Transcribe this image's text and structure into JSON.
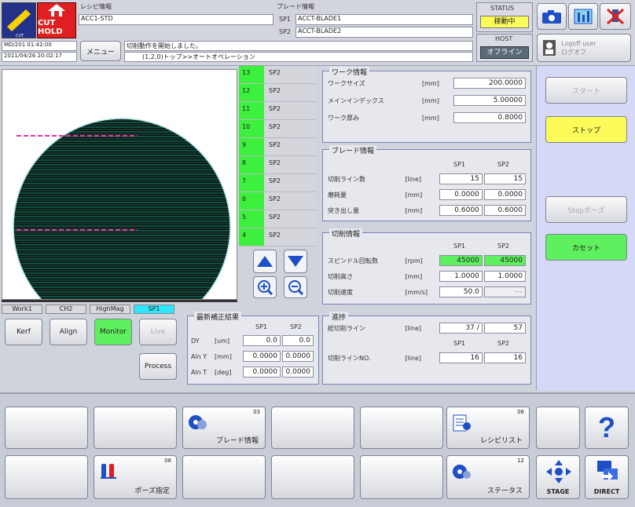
{
  "header": {
    "logo_label": "CUT HOLD",
    "recipe_title": "レシピ情報",
    "recipe_value": "ACC1-STD",
    "blade_title": "ブレード情報",
    "sp1_label": "SP1",
    "sp1_value": "ACCT-BLADE1",
    "sp2_label": "SP2",
    "sp2_value": "ACCT-BLADE2",
    "status_title": "STATUS",
    "status_value": "稼動中",
    "host_title": "HOST",
    "host_value": "オフライン",
    "datetime1": "MD/201  01:42:00",
    "datetime2": "2011/04/26 20:02:17",
    "menu_label": "メニュー",
    "message1": "切削動作を開始しました。",
    "message2": "(1,2,0)トップ>>オートオペレーション",
    "login_line1": "Logoff user",
    "login_line2": "ログオフ"
  },
  "line_list": [
    {
      "no": "13",
      "sp": "SP2"
    },
    {
      "no": "12",
      "sp": "SP2"
    },
    {
      "no": "11",
      "sp": "SP2"
    },
    {
      "no": "10",
      "sp": "SP2"
    },
    {
      "no": "9",
      "sp": "SP2"
    },
    {
      "no": "8",
      "sp": "SP2"
    },
    {
      "no": "7",
      "sp": "SP2"
    },
    {
      "no": "6",
      "sp": "SP2"
    },
    {
      "no": "5",
      "sp": "SP2"
    },
    {
      "no": "4",
      "sp": "SP2"
    }
  ],
  "tabs": [
    "Work1",
    "CH2",
    "HighMag",
    "SP1"
  ],
  "left_buttons": {
    "kerf": "Kerf",
    "align": "Align",
    "monitor": "Monitor",
    "live": "Live",
    "process": "Process"
  },
  "work_info": {
    "title": "ワーク情報",
    "rows": [
      {
        "label": "ワークサイズ",
        "unit": "[mm]",
        "value": "200.0000"
      },
      {
        "label": "メインインデックス",
        "unit": "[mm]",
        "value": "5.00000"
      },
      {
        "label": "ワーク厚み",
        "unit": "[mm]",
        "value": "0.8000"
      }
    ]
  },
  "blade_info": {
    "title": "ブレード情報",
    "sp1": "SP1",
    "sp2": "SP2",
    "rows": [
      {
        "label": "切削ライン数",
        "unit": "[line]",
        "sp1": "15",
        "sp2": "15"
      },
      {
        "label": "磨耗量",
        "unit": "[mm]",
        "sp1": "0.0000",
        "sp2": "0.0000"
      },
      {
        "label": "突き出し量",
        "unit": "[mm]",
        "sp1": "0.6000",
        "sp2": "0.6000"
      }
    ]
  },
  "cut_info": {
    "title": "切削情報",
    "sp1": "SP1",
    "sp2": "SP2",
    "rows": [
      {
        "label": "スピンドル回転数",
        "unit": "[rpm]",
        "sp1": "45000",
        "sp2": "45000"
      },
      {
        "label": "切削高さ",
        "unit": "[mm]",
        "sp1": "1.0000",
        "sp2": "1.0000"
      },
      {
        "label": "切削速度",
        "unit": "[mm/s]",
        "sp1": "50.0",
        "sp2": "---"
      }
    ]
  },
  "latest_correction": {
    "title": "最新補正結果",
    "sp1": "SP1",
    "sp2": "SP2",
    "rows": [
      {
        "label": "DY",
        "unit": "[um]",
        "sp1": "0.0",
        "sp2": "0.0"
      },
      {
        "label": "Aln Y",
        "unit": "[mm]",
        "sp1": "0.0000",
        "sp2": "0.0000"
      },
      {
        "label": "Aln T",
        "unit": "[deg]",
        "sp1": "0.0000",
        "sp2": "0.0000"
      }
    ]
  },
  "progress": {
    "title": "進捗",
    "total_label": "総切削ライン",
    "total_unit": "[line]",
    "total_done": "37 /",
    "total_all": "57",
    "sp1": "SP1",
    "sp2": "SP2",
    "line_label": "切削ラインNO.",
    "line_unit": "[line]",
    "line_sp1": "16",
    "line_sp2": "16"
  },
  "right_buttons": {
    "start": "スタート",
    "stop": "ストップ",
    "step_pause": "Stepポーズ",
    "cassette": "カセット"
  },
  "bottom_buttons": {
    "blade_num": "03",
    "blade_label": "ブレード情報",
    "recipe_num": "06",
    "recipe_label": "レシピリスト",
    "pause_num": "08",
    "pause_label": "ポーズ指定",
    "status_num": "12",
    "status_label": "ステータス",
    "stage_label": "STAGE",
    "direct_label": "DIRECT",
    "help_label": "?"
  },
  "colors": {
    "wafer_line": "#1d8a7a",
    "green_accent": "#5ef05e",
    "yellow_accent": "#fbfb5a",
    "magenta": "#e8319c",
    "purple_panel": "#d6d9f5"
  }
}
